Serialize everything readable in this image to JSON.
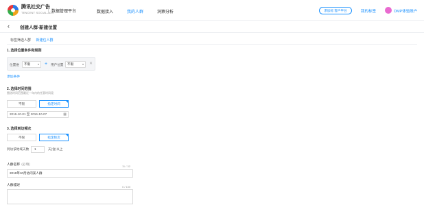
{
  "colors": {
    "accent": "#1890ff",
    "avatar": "#e96ad0"
  },
  "header": {
    "brand": "腾讯社交广告",
    "brand_sub": "TENCENT SOCIAL ADS",
    "platform": "数据管理平台",
    "nav": [
      "数据接入",
      "我的人群",
      "洞察分析"
    ],
    "active_nav": "我的人群",
    "pill_button": "添加标 客户平台",
    "my_tags": "我的标签",
    "user": "DMP体验账户"
  },
  "page": {
    "title": "创建人群-新建位置"
  },
  "tabs": [
    "标签筛选人群",
    "新建位人群"
  ],
  "active_tab": "新建位人群",
  "section1": {
    "title": "1. 选择位置条件和规则",
    "cond_label_1": "位置维",
    "cond_value_1": "不限",
    "cond_label_2": "用户位置",
    "cond_value_2": "不限",
    "add_link": "添加条件"
  },
  "section2": {
    "title": "2. 选择时间范围",
    "hint": "圈选时间范围最近一年内的任意时间段",
    "opt_unlimited": "不限",
    "opt_custom": "指定时间",
    "date_range": "2016-10-01 至 2016-10-07"
  },
  "section3": {
    "title": "3. 选择到访频次",
    "opt_unlimited": "不限",
    "opt_custom": "指定频次",
    "freq_label": "到访该地域天数",
    "freq_value": "1",
    "freq_suffix": "天(含)以上"
  },
  "name_field": {
    "label": "人群名称",
    "required": "(必填)",
    "counter": "11 / 32",
    "value": "2016年10月访问某人群"
  },
  "desc_field": {
    "label": "人群描述",
    "counter": "0 / 100"
  }
}
